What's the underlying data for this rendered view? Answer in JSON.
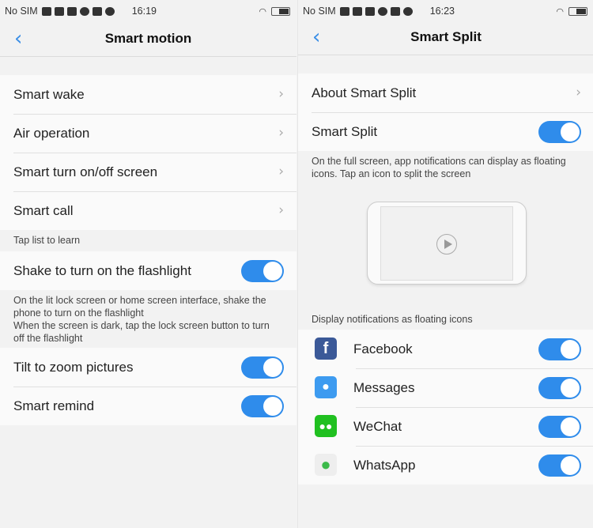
{
  "left": {
    "status": {
      "carrier": "No SIM",
      "time": "16:19"
    },
    "title": "Smart motion",
    "nav_items": [
      {
        "label": "Smart wake"
      },
      {
        "label": "Air operation"
      },
      {
        "label": "Smart turn on/off screen"
      },
      {
        "label": "Smart call"
      }
    ],
    "section_label": "Tap list to learn",
    "flashlight": {
      "label": "Shake to turn on the flashlight",
      "on": true
    },
    "flashlight_desc": "On the lit lock screen or home screen interface, shake the phone to turn on the flashlight\nWhen the screen is dark, tap the lock screen button to turn off the flashlight",
    "toggles": [
      {
        "label": "Tilt to zoom pictures",
        "on": true
      },
      {
        "label": "Smart remind",
        "on": true
      }
    ]
  },
  "right": {
    "status": {
      "carrier": "No SIM",
      "time": "16:23"
    },
    "title": "Smart Split",
    "about": "About Smart Split",
    "smart_split": {
      "label": "Smart Split",
      "on": true
    },
    "desc": "On the full screen, app notifications can display as floating icons. Tap an icon to split the screen",
    "section_label": "Display notifications as floating icons",
    "apps": [
      {
        "label": "Facebook",
        "on": true,
        "icon": "facebook-icon",
        "color": "#3b5998"
      },
      {
        "label": "Messages",
        "on": true,
        "icon": "messages-icon",
        "color": "#3d9bf0"
      },
      {
        "label": "WeChat",
        "on": true,
        "icon": "wechat-icon",
        "color": "#20c020"
      },
      {
        "label": "WhatsApp",
        "on": true,
        "icon": "whatsapp-icon",
        "color": "#3cba4a"
      }
    ]
  },
  "colors": {
    "accent": "#2f8ceb",
    "back": "#3a8ee6"
  }
}
